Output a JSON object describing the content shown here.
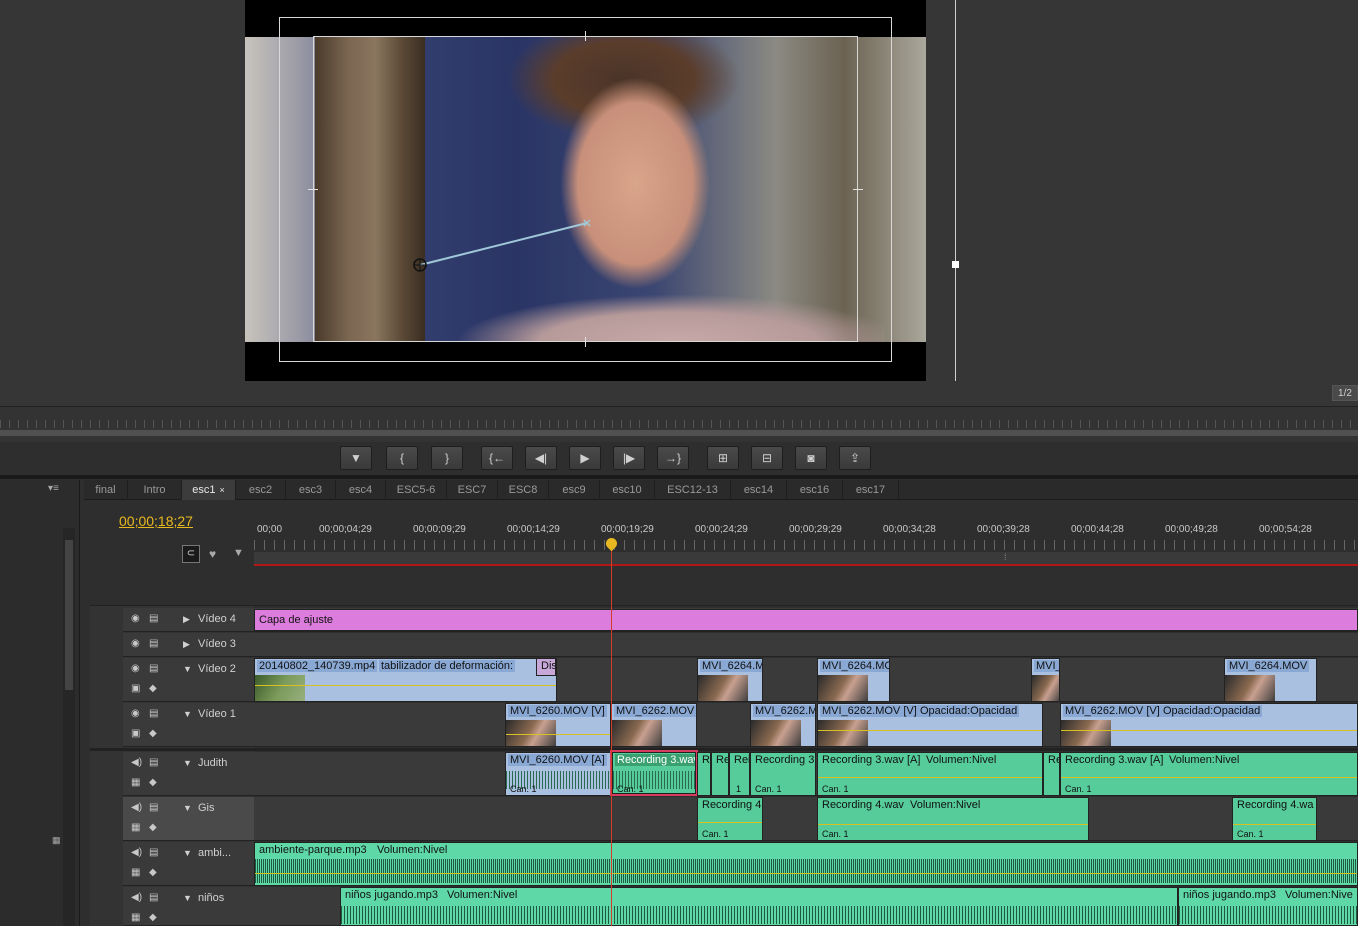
{
  "monitor": {
    "page_indicator": "1/2"
  },
  "transport": {
    "buttons": [
      "marker-icon",
      "mark-in-icon",
      "mark-out-icon",
      "go-to-in-icon",
      "step-back-icon",
      "play-icon",
      "step-forward-icon",
      "go-to-out-icon",
      "lift-icon",
      "extract-icon",
      "export-frame-icon",
      "trim-icon"
    ]
  },
  "tabs": [
    "final",
    "Intro",
    "esc1",
    "esc2",
    "esc3",
    "esc4",
    "ESC5-6",
    "ESC7",
    "ESC8",
    "esc9",
    "esc10",
    "ESC12-13",
    "esc14",
    "esc16",
    "esc17"
  ],
  "active_tab": "esc1",
  "timecode": "00;00;18;27",
  "ruler": [
    "00;00",
    "00;00;04;29",
    "00;00;09;29",
    "00;00;14;29",
    "00;00;19;29",
    "00;00;24;29",
    "00;00;29;29",
    "00;00;34;28",
    "00;00;39;28",
    "00;00;44;28",
    "00;00;49;28",
    "00;00;54;28"
  ],
  "tracks": {
    "v4": "Vídeo 4",
    "v3": "Vídeo 3",
    "v2": "Vídeo 2",
    "v1": "Vídeo 1",
    "a1": "Judith",
    "a2": "Gis",
    "a3": "ambi...",
    "a4": "niños"
  },
  "clips": {
    "adjust": "Capa de ajuste",
    "v2_a": "20140802_140739.mp4",
    "v2_a_fx": "tabilizador de deformación:",
    "v2_dis": "Dis",
    "v2_b": "MVI_6264.M",
    "v2_c": "MVI_6264.MC",
    "v2_d": "MVI_",
    "v2_e": "MVI_6264.MOV",
    "v1_a": "MVI_6260.MOV [V]",
    "v1_b": "MVI_6262.MOV [",
    "v1_c": "MVI_6262.M",
    "v1_d": "MVI_6262.MOV [V]",
    "v1_d_fx": "Opacidad:Opacidad",
    "v1_e": "MVI_6262.MOV [V]",
    "v1_e_fx": "Opacidad:Opacidad",
    "a1_a": "MVI_6260.MOV [A]",
    "a1_b": "Recording 3.wav",
    "a1_r1": "Re",
    "a1_r2": "Re",
    "a1_r3": "Rei",
    "a1_c": "Recording 3",
    "a1_d": "Recording 3.wav [A]",
    "a1_d_fx": "Volumen:Nivel",
    "a1_e": "Re",
    "a1_f": "Recording 3.wav [A]",
    "a1_f_fx": "Volumen:Nivel",
    "can1": "Can. 1",
    "num1": "1",
    "a2_a": "Recording 4",
    "a2_b": "Recording 4.wav",
    "a2_b_fx": "Volumen:Nivel",
    "a2_c": "Recording 4.wa",
    "a3_a": "ambiente-parque.mp3",
    "a3_a_fx": "Volumen:Nivel",
    "a4_a": "niños jugando.mp3",
    "a4_a_fx": "Volumen:Nivel",
    "a4_b": "niños jugando.mp3",
    "a4_b_fx": "Volumen:Nive"
  }
}
